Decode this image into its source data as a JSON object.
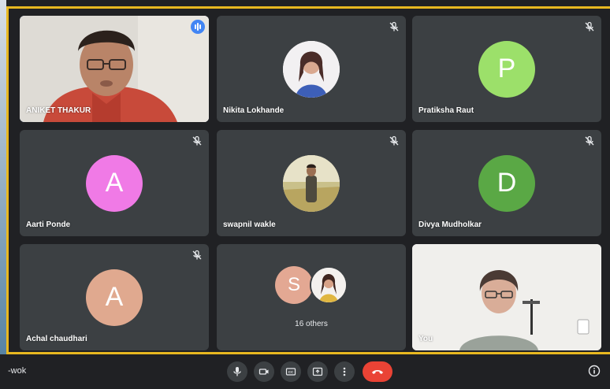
{
  "meeting": {
    "code_fragment": "-wok",
    "others_count_label": "16 others"
  },
  "participants": [
    {
      "name": "ANIKET THAKUR",
      "display_name": "ANIKET THAKUR",
      "type": "video",
      "speaking": true
    },
    {
      "name": "Nikita Lokhande",
      "type": "photo",
      "muted": true
    },
    {
      "name": "Pratiksha Raut",
      "type": "letter",
      "letter": "P",
      "color": "#9ce06a",
      "muted": true
    },
    {
      "name": "Aarti Ponde",
      "type": "letter",
      "letter": "A",
      "color": "#f07ae6",
      "muted": true
    },
    {
      "name": "swapnil wakle",
      "type": "photo",
      "muted": true
    },
    {
      "name": "Divya Mudholkar",
      "type": "letter",
      "letter": "D",
      "color": "#5aa845",
      "muted": true
    },
    {
      "name": "Achal chaudhari",
      "type": "letter",
      "letter": "A",
      "color": "#e0a98f",
      "muted": true
    },
    {
      "name": "You",
      "type": "video"
    }
  ],
  "others_tile": {
    "letter": "S",
    "color": "#e3a893",
    "label": "16 others"
  },
  "controls": [
    {
      "name": "microphone",
      "icon": "mic-icon"
    },
    {
      "name": "camera",
      "icon": "camera-icon"
    },
    {
      "name": "captions",
      "icon": "cc-icon"
    },
    {
      "name": "present",
      "icon": "present-icon"
    },
    {
      "name": "more",
      "icon": "more-vert-icon"
    },
    {
      "name": "leave-call",
      "icon": "hangup-icon",
      "color": "#ea4335"
    }
  ],
  "colors": {
    "tile_bg": "#3c4043",
    "accent_border": "#e8b820",
    "speaking": "#4285f4"
  }
}
